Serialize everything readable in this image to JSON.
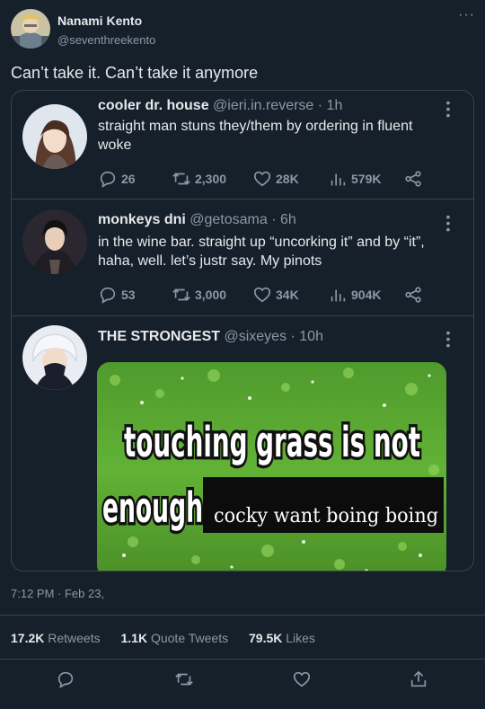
{
  "author": {
    "name": "Nanami Kento",
    "handle": "@seventhreekento",
    "more": "···"
  },
  "tweet_text": "Can’t take it. Can’t take it anymore",
  "quoted": [
    {
      "name": "cooler dr. house",
      "handle": "@ieri.in.reverse · 1h",
      "text": "straight man stuns they/them by ordering in fluent woke",
      "replies": "26",
      "retweets": "2,300",
      "likes": "28K",
      "views": "579K"
    },
    {
      "name": "monkeys dni",
      "handle": "@getosama · 6h",
      "text": "in the wine bar. straight up “uncorking it” and by “it”, haha, well. let’s justr say. My pinots",
      "replies": "53",
      "retweets": "3,000",
      "likes": "34K",
      "views": "904K"
    },
    {
      "name": "THE STRONGEST",
      "handle": "@sixeyes · 10h",
      "meme": {
        "line1": "touching grass is not",
        "line2": "enough",
        "overlay": "cocky want boing boing"
      }
    }
  ],
  "timestamp": "7:12 PM · Feb 23,",
  "stats": {
    "retweets_num": "17.2K",
    "retweets_label": "Retweets",
    "quotes_num": "1.1K",
    "quotes_label": "Quote Tweets",
    "likes_num": "79.5K",
    "likes_label": "Likes"
  },
  "colors": {
    "background": "#15202b",
    "border": "#38444d",
    "secondary_text": "#8b98a5",
    "primary_text": "#e7e9ea"
  }
}
